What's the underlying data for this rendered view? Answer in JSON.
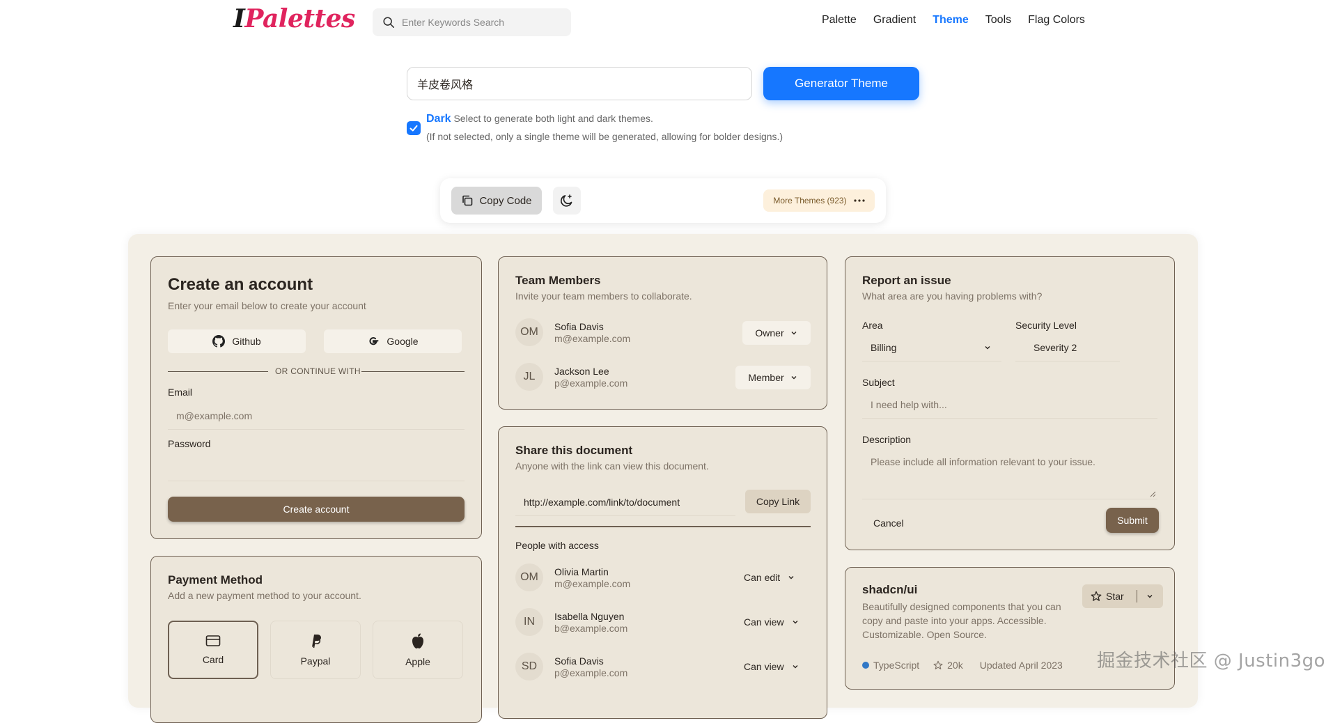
{
  "nav": {
    "logo_first": "I",
    "logo_rest": "Palettes",
    "search_placeholder": "Enter Keywords Search",
    "links": [
      "Palette",
      "Gradient",
      "Theme",
      "Tools",
      "Flag Colors"
    ],
    "active_link": "Theme"
  },
  "generator": {
    "input_value": "羊皮卷风格",
    "button_label": "Generator Theme",
    "dark_label": "Dark",
    "dark_desc": "Select to generate both light and dark themes.",
    "dark_note": "(If not selected, only a single theme will be generated, allowing for bolder designs.)",
    "dark_checked": true
  },
  "toolbar": {
    "copy_code": "Copy Code",
    "more_themes": "More Themes (923)"
  },
  "create_account": {
    "title": "Create an account",
    "subtitle": "Enter your email below to create your account",
    "github": "Github",
    "google": "Google",
    "divider": "OR CONTINUE WITH",
    "email_label": "Email",
    "email_placeholder": "m@example.com",
    "password_label": "Password",
    "submit": "Create account"
  },
  "payment": {
    "title": "Payment Method",
    "subtitle": "Add a new payment method to your account.",
    "options": [
      "Card",
      "Paypal",
      "Apple"
    ]
  },
  "team": {
    "title": "Team Members",
    "subtitle": "Invite your team members to collaborate.",
    "members": [
      {
        "initials": "OM",
        "name": "Sofia Davis",
        "email": "m@example.com",
        "role": "Owner"
      },
      {
        "initials": "JL",
        "name": "Jackson Lee",
        "email": "p@example.com",
        "role": "Member"
      }
    ]
  },
  "share": {
    "title": "Share this document",
    "subtitle": "Anyone with the link can view this document.",
    "link": "http://example.com/link/to/document",
    "copy_link": "Copy Link",
    "people_label": "People with access",
    "people": [
      {
        "initials": "OM",
        "name": "Olivia Martin",
        "email": "m@example.com",
        "access": "Can edit"
      },
      {
        "initials": "IN",
        "name": "Isabella Nguyen",
        "email": "b@example.com",
        "access": "Can view"
      },
      {
        "initials": "SD",
        "name": "Sofia Davis",
        "email": "p@example.com",
        "access": "Can view"
      }
    ]
  },
  "report": {
    "title": "Report an issue",
    "subtitle": "What area are you having problems with?",
    "area_label": "Area",
    "area_value": "Billing",
    "security_label": "Security Level",
    "security_value": "Severity 2",
    "subject_label": "Subject",
    "subject_placeholder": "I need help with...",
    "description_label": "Description",
    "description_placeholder": "Please include all information relevant to your issue.",
    "cancel": "Cancel",
    "submit": "Submit"
  },
  "repo": {
    "name": "shadcn/ui",
    "description": "Beautifully designed components that you can copy and paste into your apps. Accessible. Customizable. Open Source.",
    "star": "Star",
    "language": "TypeScript",
    "language_color": "#3178c6",
    "stars": "20k",
    "updated": "Updated April 2023"
  },
  "watermark": "掘金技术社区 @ Justin3go",
  "colors": {
    "accent_blue": "#1677ff",
    "primary_brown": "#78624c",
    "card_bg": "#ece6da",
    "logo_pink": "#e0245e"
  }
}
